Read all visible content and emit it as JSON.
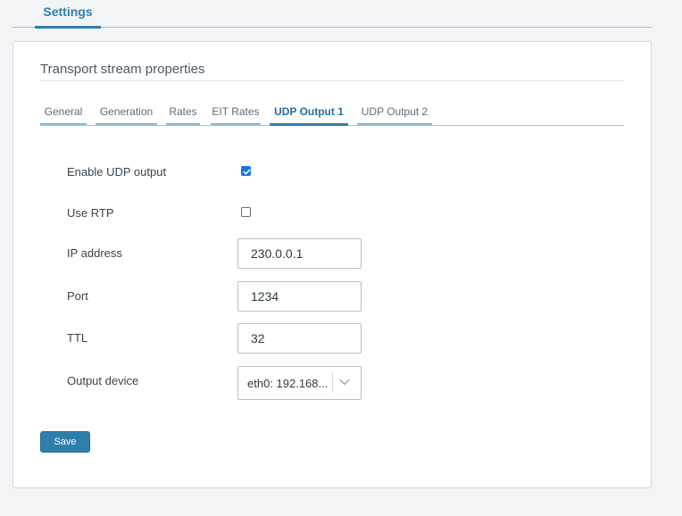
{
  "top_nav": {
    "tabs": [
      {
        "label": "Settings",
        "active": true
      }
    ]
  },
  "panel": {
    "title": "Transport stream properties",
    "tabs": [
      {
        "label": "General",
        "active": false
      },
      {
        "label": "Generation",
        "active": false
      },
      {
        "label": "Rates",
        "active": false
      },
      {
        "label": "EIT Rates",
        "active": false
      },
      {
        "label": "UDP Output 1",
        "active": true
      },
      {
        "label": "UDP Output 2",
        "active": false
      }
    ]
  },
  "form": {
    "enable_udp_output": {
      "label": "Enable UDP output",
      "checked": true
    },
    "use_rtp": {
      "label": "Use RTP",
      "checked": false
    },
    "ip_address": {
      "label": "IP address",
      "value": "230.0.0.1"
    },
    "port": {
      "label": "Port",
      "value": "1234"
    },
    "ttl": {
      "label": "TTL",
      "value": "32"
    },
    "output_device": {
      "label": "Output device",
      "value": "eth0: 192.168..."
    },
    "save_label": "Save"
  },
  "colors": {
    "accent": "#2e7fb0",
    "checkbox_checked": "#1a73e8",
    "panel_background": "#ffffff",
    "page_background": "#f3f4f6"
  },
  "icons": {
    "checkmark": "checkmark-icon",
    "dropdown": "chevron-down-icon"
  }
}
